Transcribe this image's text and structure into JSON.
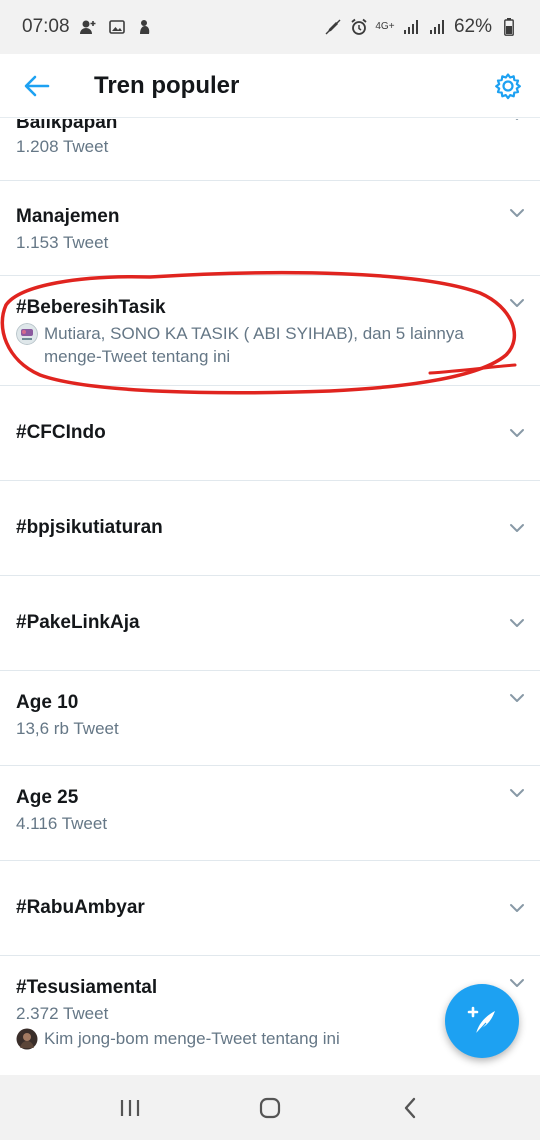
{
  "status_bar": {
    "time": "07:08",
    "network": "4G+",
    "battery": "62%"
  },
  "header": {
    "title": "Tren populer"
  },
  "trends": [
    {
      "name": "Balikpapan",
      "count": "1.208 Tweet"
    },
    {
      "name": "Manajemen",
      "count": "1.153 Tweet"
    },
    {
      "name": "#BeberesihTasik",
      "context": "Mutiara, SONO KA TASIK ( ABI SYIHAB), dan 5 lainnya menge-Tweet tentang ini"
    },
    {
      "name": "#CFCIndo"
    },
    {
      "name": "#bpjsikutiaturan"
    },
    {
      "name": "#PakeLinkAja"
    },
    {
      "name": "Age 10",
      "count": "13,6 rb Tweet"
    },
    {
      "name": "Age 25",
      "count": "4.116 Tweet"
    },
    {
      "name": "#RabuAmbyar"
    },
    {
      "name": "#Tesusiamental",
      "count": "2.372 Tweet",
      "context": "Kim jong-bom menge-Tweet tentang ini"
    }
  ],
  "colors": {
    "accent": "#1da1f2",
    "highlight": "#e0241f",
    "secondary_text": "#657786"
  }
}
